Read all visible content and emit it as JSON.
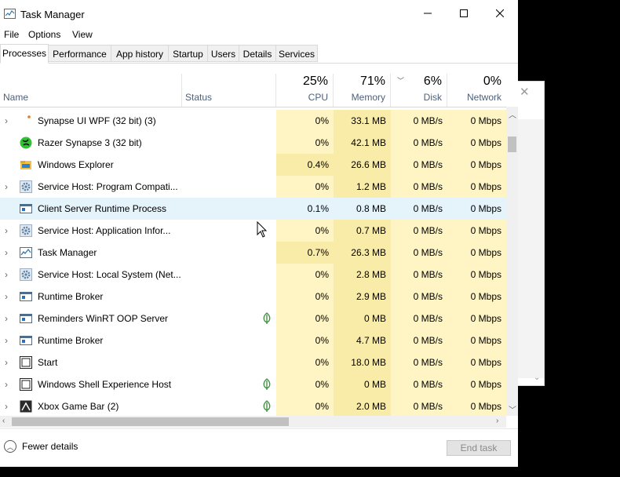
{
  "window": {
    "title": "Task Manager"
  },
  "menu": [
    "File",
    "Options",
    "View"
  ],
  "tabs": [
    "Processes",
    "Performance",
    "App history",
    "Startup",
    "Users",
    "Details",
    "Services"
  ],
  "active_tab": "Processes",
  "columns": {
    "name": "Name",
    "status": "Status",
    "cpu": {
      "pct": "25%",
      "label": "CPU"
    },
    "memory": {
      "pct": "71%",
      "label": "Memory"
    },
    "disk": {
      "pct": "6%",
      "label": "Disk"
    },
    "network": {
      "pct": "0%",
      "label": "Network"
    }
  },
  "colors": {
    "usage_fill": "#fff4c4",
    "usage_fill_strong": "#f9eca8",
    "highlight": "#e5f3fb",
    "leaf": "#3a8e3a"
  },
  "processes": [
    {
      "name": "Synapse UI WPF (32 bit) (3)",
      "icon": "synapse-dot-icon",
      "expandable": true,
      "eco": false,
      "cpu": "0%",
      "memory": "33.1 MB",
      "disk": "0 MB/s",
      "network": "0 Mbps"
    },
    {
      "name": "Razer Synapse 3 (32 bit)",
      "icon": "razer-icon",
      "expandable": false,
      "eco": false,
      "cpu": "0%",
      "memory": "42.1 MB",
      "disk": "0 MB/s",
      "network": "0 Mbps"
    },
    {
      "name": "Windows Explorer",
      "icon": "folder-icon",
      "expandable": false,
      "eco": false,
      "cpu": "0.4%",
      "memory": "26.6 MB",
      "disk": "0 MB/s",
      "network": "0 Mbps"
    },
    {
      "name": "Service Host: Program Compati...",
      "icon": "gear-icon",
      "expandable": true,
      "eco": false,
      "cpu": "0%",
      "memory": "1.2 MB",
      "disk": "0 MB/s",
      "network": "0 Mbps"
    },
    {
      "name": "Client Server Runtime Process",
      "icon": "window-app-icon",
      "expandable": false,
      "eco": false,
      "cpu": "0.1%",
      "memory": "0.8 MB",
      "disk": "0 MB/s",
      "network": "0 Mbps",
      "highlighted": true
    },
    {
      "name": "Service Host: Application Infor...",
      "icon": "gear-icon",
      "expandable": true,
      "eco": false,
      "cpu": "0%",
      "memory": "0.7 MB",
      "disk": "0 MB/s",
      "network": "0 Mbps"
    },
    {
      "name": "Task Manager",
      "icon": "task-manager-icon",
      "expandable": true,
      "eco": false,
      "cpu": "0.7%",
      "memory": "26.3 MB",
      "disk": "0 MB/s",
      "network": "0 Mbps"
    },
    {
      "name": "Service Host: Local System (Net...",
      "icon": "gear-icon",
      "expandable": true,
      "eco": false,
      "cpu": "0%",
      "memory": "2.8 MB",
      "disk": "0 MB/s",
      "network": "0 Mbps"
    },
    {
      "name": "Runtime Broker",
      "icon": "window-app-icon",
      "expandable": true,
      "eco": false,
      "cpu": "0%",
      "memory": "2.9 MB",
      "disk": "0 MB/s",
      "network": "0 Mbps"
    },
    {
      "name": "Reminders WinRT OOP Server",
      "icon": "window-app-icon",
      "expandable": true,
      "eco": true,
      "cpu": "0%",
      "memory": "0 MB",
      "disk": "0 MB/s",
      "network": "0 Mbps"
    },
    {
      "name": "Runtime Broker",
      "icon": "window-app-icon",
      "expandable": true,
      "eco": false,
      "cpu": "0%",
      "memory": "4.7 MB",
      "disk": "0 MB/s",
      "network": "0 Mbps"
    },
    {
      "name": "Start",
      "icon": "start-icon",
      "expandable": true,
      "eco": false,
      "cpu": "0%",
      "memory": "18.0 MB",
      "disk": "0 MB/s",
      "network": "0 Mbps"
    },
    {
      "name": "Windows Shell Experience Host",
      "icon": "start-icon",
      "expandable": true,
      "eco": true,
      "cpu": "0%",
      "memory": "0 MB",
      "disk": "0 MB/s",
      "network": "0 Mbps"
    },
    {
      "name": "Xbox Game Bar (2)",
      "icon": "xbox-game-bar-icon",
      "expandable": true,
      "eco": true,
      "cpu": "0%",
      "memory": "2.0 MB",
      "disk": "0 MB/s",
      "network": "0 Mbps"
    }
  ],
  "footer": {
    "fewer_details": "Fewer details",
    "end_task": "End task"
  }
}
